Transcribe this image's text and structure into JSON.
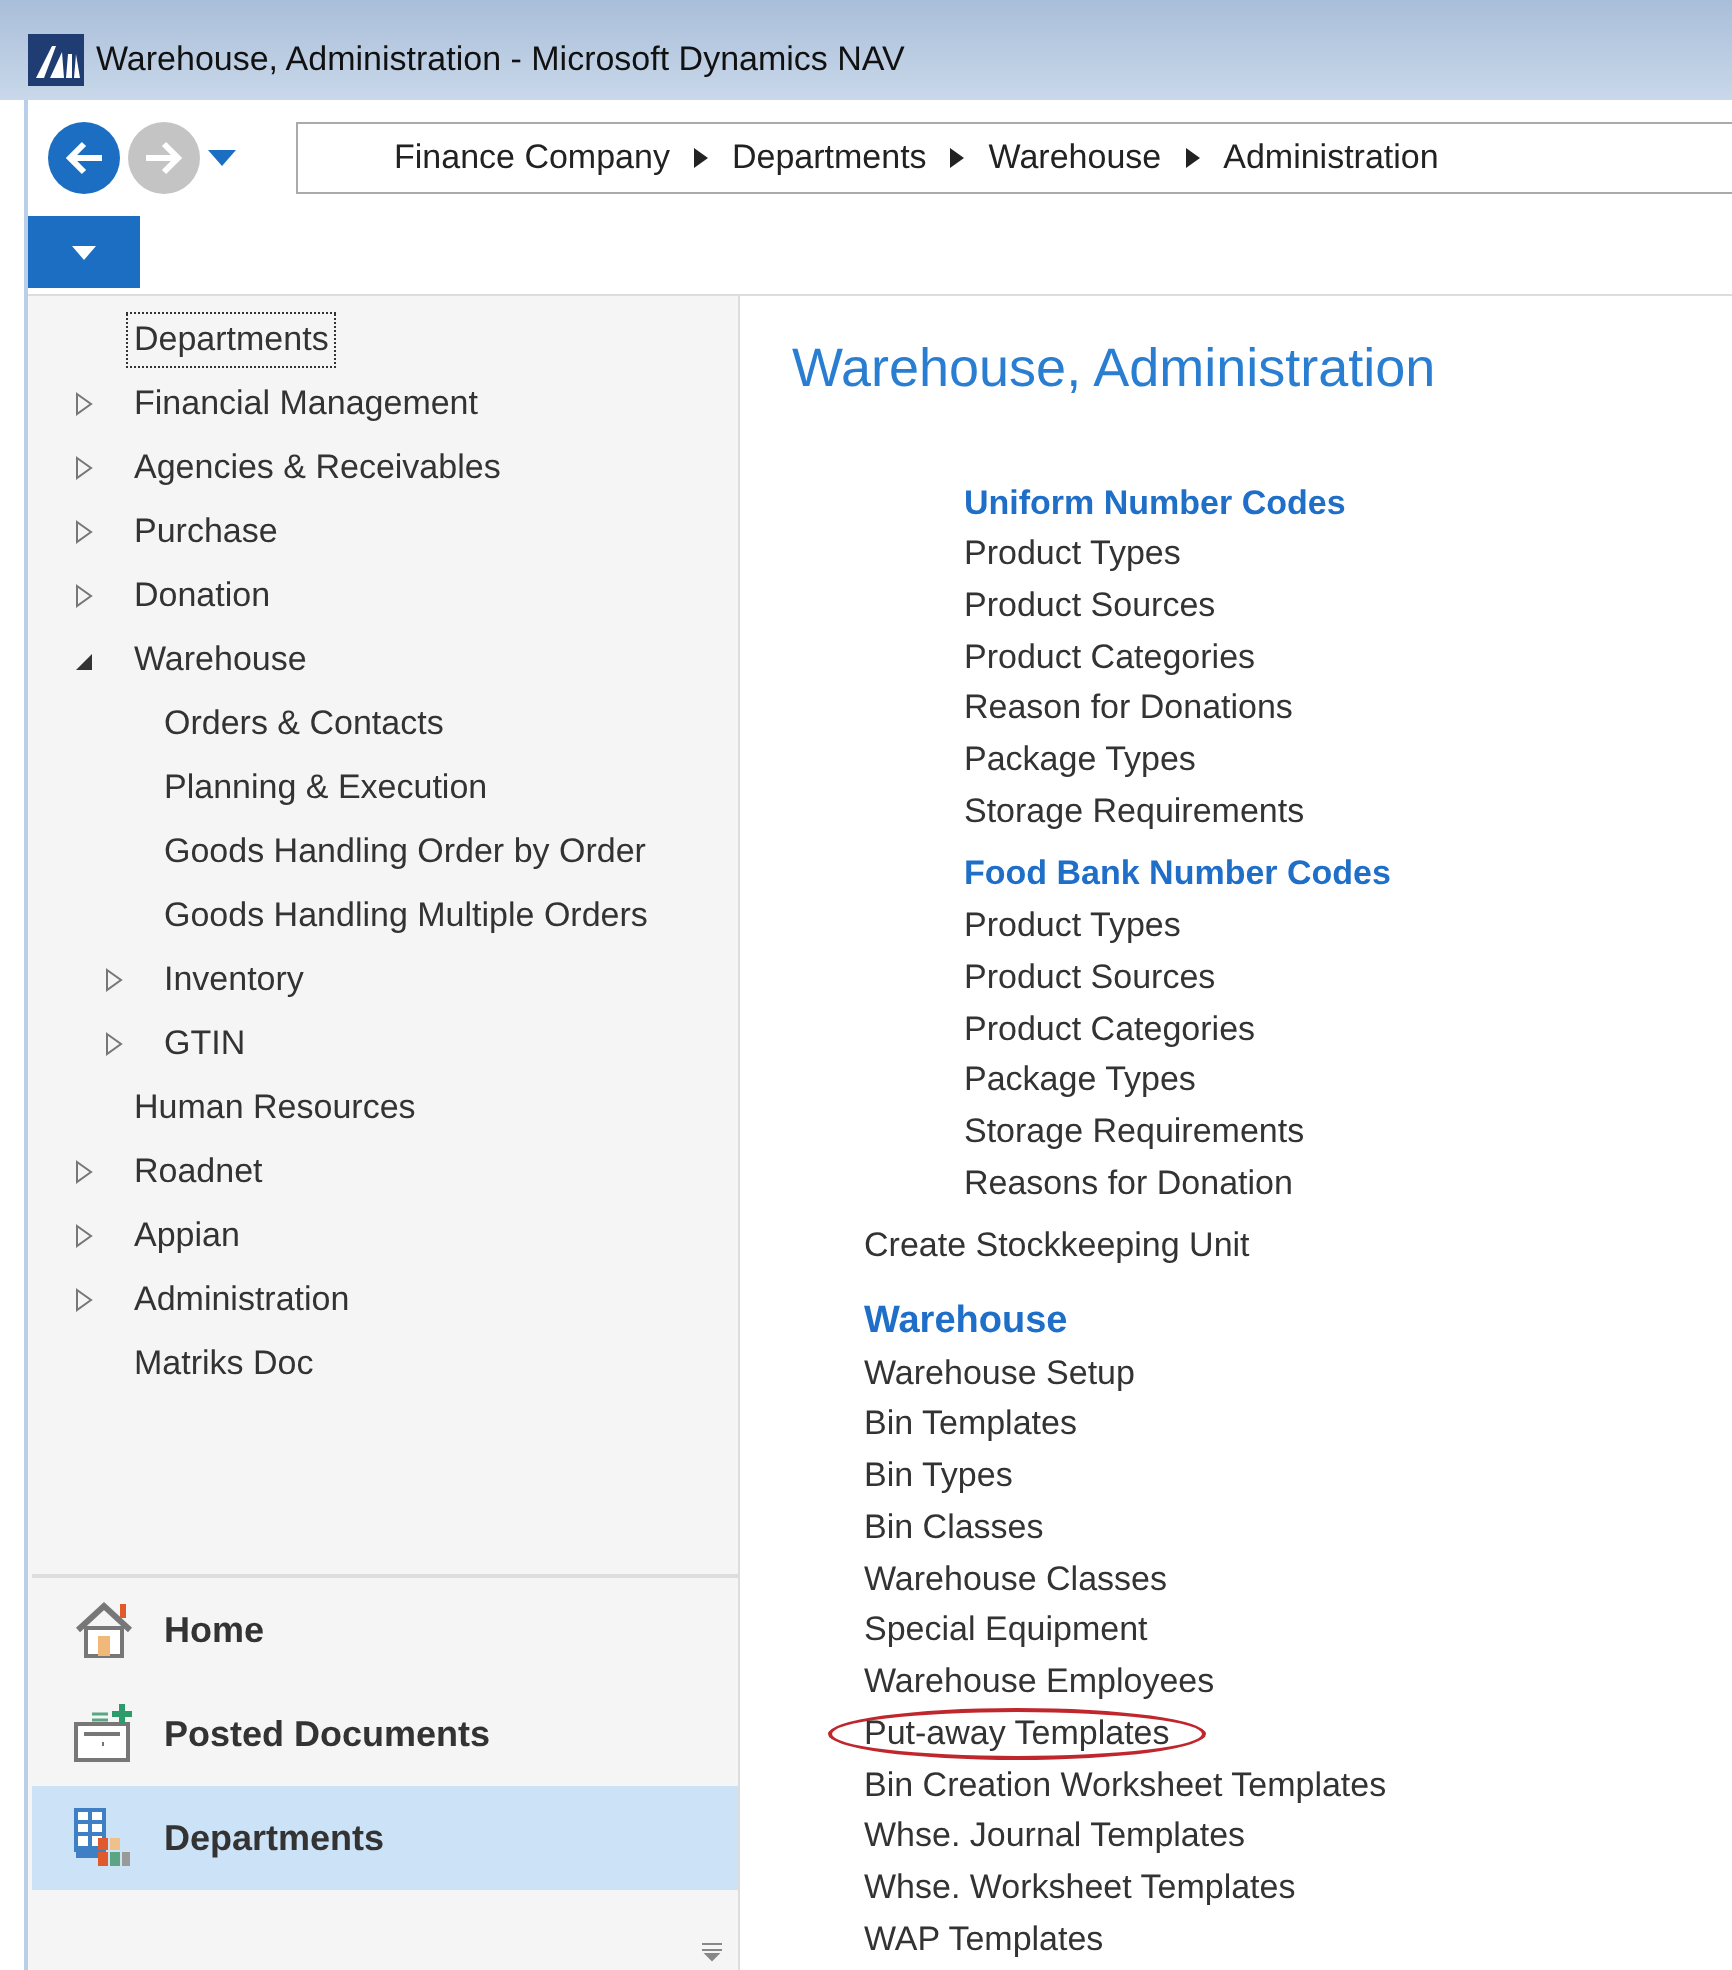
{
  "window": {
    "title": "Warehouse, Administration - Microsoft Dynamics NAV"
  },
  "navigation": {
    "back_enabled": true,
    "forward_enabled": false,
    "breadcrumb": [
      "Finance Company",
      "Departments",
      "Warehouse",
      "Administration"
    ]
  },
  "sidebar": {
    "tree": [
      {
        "label": "Departments",
        "kind": "leaf",
        "selected": true
      },
      {
        "label": "Financial Management",
        "kind": "group",
        "expanded": false,
        "selected": false
      },
      {
        "label": "Agencies & Receivables",
        "kind": "group",
        "expanded": false,
        "selected": false
      },
      {
        "label": "Purchase",
        "kind": "group",
        "expanded": false,
        "selected": false
      },
      {
        "label": "Donation",
        "kind": "group",
        "expanded": false,
        "selected": false
      },
      {
        "label": "Warehouse",
        "kind": "group",
        "expanded": true,
        "selected": false,
        "children": [
          {
            "label": "Orders & Contacts",
            "kind": "leaf",
            "selected": false
          },
          {
            "label": "Planning & Execution",
            "kind": "leaf",
            "selected": false
          },
          {
            "label": "Goods Handling Order by Order",
            "kind": "leaf",
            "selected": false
          },
          {
            "label": "Goods Handling Multiple Orders",
            "kind": "leaf",
            "selected": false
          },
          {
            "label": "Inventory",
            "kind": "group",
            "expanded": false,
            "selected": false
          },
          {
            "label": "GTIN",
            "kind": "group",
            "expanded": false,
            "selected": false
          }
        ]
      },
      {
        "label": "Human Resources",
        "kind": "leaf",
        "selected": false
      },
      {
        "label": "Roadnet",
        "kind": "group",
        "expanded": false,
        "selected": false
      },
      {
        "label": "Appian",
        "kind": "group",
        "expanded": false,
        "selected": false
      },
      {
        "label": "Administration",
        "kind": "group",
        "expanded": false,
        "selected": false
      },
      {
        "label": "Matriks Doc",
        "kind": "leaf",
        "selected": false
      }
    ],
    "buttons": [
      {
        "label": "Home",
        "kind": "home",
        "selected": false
      },
      {
        "label": "Posted Documents",
        "kind": "posted",
        "selected": false
      },
      {
        "label": "Departments",
        "kind": "departments",
        "selected": true
      }
    ]
  },
  "content": {
    "title": "Warehouse, Administration",
    "items": [
      {
        "kind": "subheading",
        "text": "Uniform Number Codes",
        "children": [
          {
            "kind": "link",
            "text": "Product Types",
            "circled": false
          },
          {
            "kind": "link",
            "text": "Product Sources",
            "circled": false
          },
          {
            "kind": "link",
            "text": "Product Categories",
            "circled": false
          },
          {
            "kind": "link",
            "text": "Reason for Donations",
            "circled": false
          },
          {
            "kind": "link",
            "text": "Package Types",
            "circled": false
          },
          {
            "kind": "link",
            "text": "Storage Requirements",
            "circled": false
          }
        ]
      },
      {
        "kind": "subheading",
        "text": "Food Bank Number Codes",
        "children": [
          {
            "kind": "link",
            "text": "Product Types",
            "circled": false
          },
          {
            "kind": "link",
            "text": "Product Sources",
            "circled": false
          },
          {
            "kind": "link",
            "text": "Product Categories",
            "circled": false
          },
          {
            "kind": "link",
            "text": "Package Types",
            "circled": false
          },
          {
            "kind": "link",
            "text": "Storage Requirements",
            "circled": false
          },
          {
            "kind": "link",
            "text": "Reasons for Donation",
            "circled": false
          }
        ]
      },
      {
        "kind": "link",
        "text": "Create Stockkeeping Unit",
        "circled": false
      },
      {
        "kind": "heading",
        "text": "Warehouse"
      },
      {
        "kind": "link",
        "text": "Warehouse Setup",
        "circled": false
      },
      {
        "kind": "link",
        "text": "Bin Templates",
        "circled": false
      },
      {
        "kind": "link",
        "text": "Bin Types",
        "circled": false
      },
      {
        "kind": "link",
        "text": "Bin Classes",
        "circled": false
      },
      {
        "kind": "link",
        "text": "Warehouse Classes",
        "circled": false
      },
      {
        "kind": "link",
        "text": "Special Equipment",
        "circled": false
      },
      {
        "kind": "link",
        "text": "Warehouse Employees",
        "circled": false
      },
      {
        "kind": "link",
        "text": "Put-away Templates",
        "circled": true
      },
      {
        "kind": "link",
        "text": "Bin Creation Worksheet Templates",
        "circled": false
      },
      {
        "kind": "link",
        "text": "Whse. Journal Templates",
        "circled": false
      },
      {
        "kind": "link",
        "text": "Whse. Worksheet Templates",
        "circled": false
      },
      {
        "kind": "link",
        "text": "WAP Templates",
        "circled": false
      }
    ]
  }
}
